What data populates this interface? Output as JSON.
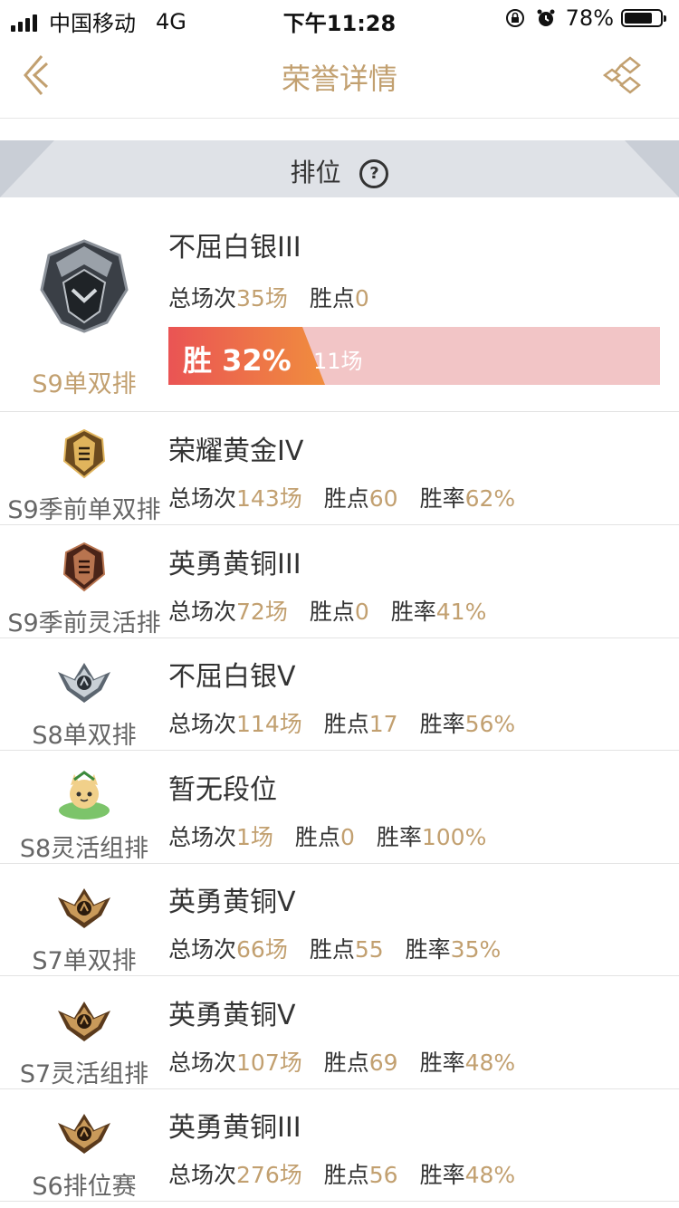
{
  "status_bar": {
    "carrier": "中国移动",
    "network": "4G",
    "time": "下午11:28",
    "battery": "78%",
    "battery_level": 0.78
  },
  "nav": {
    "title": "荣誉详情"
  },
  "section": {
    "label": "排位",
    "help": "?"
  },
  "current": {
    "queue": "S9单双排",
    "tier": "不屈白银III",
    "games_label": "总场次",
    "games": "35场",
    "points_label": "胜点",
    "points": "0",
    "win_label": "胜 32%",
    "win_games": "11场",
    "win_fraction": 0.32
  },
  "history": [
    {
      "queue": "S9季前单双排",
      "tier": "荣耀黄金IV",
      "games": "143场",
      "points": "60",
      "rate": "62%",
      "badge": "gold"
    },
    {
      "queue": "S9季前灵活排",
      "tier": "英勇黄铜III",
      "games": "72场",
      "points": "0",
      "rate": "41%",
      "badge": "bronze-dark"
    },
    {
      "queue": "S8单双排",
      "tier": "不屈白银V",
      "games": "114场",
      "points": "17",
      "rate": "56%",
      "badge": "silver"
    },
    {
      "queue": "S8灵活组排",
      "tier": "暂无段位",
      "games": "1场",
      "points": "0",
      "rate": "100%",
      "badge": "cat"
    },
    {
      "queue": "S7单双排",
      "tier": "英勇黄铜V",
      "games": "66场",
      "points": "55",
      "rate": "35%",
      "badge": "bronze"
    },
    {
      "queue": "S7灵活组排",
      "tier": "英勇黄铜V",
      "games": "107场",
      "points": "69",
      "rate": "48%",
      "badge": "bronze"
    },
    {
      "queue": "S6排位赛",
      "tier": "英勇黄铜III",
      "games": "276场",
      "points": "56",
      "rate": "48%",
      "badge": "bronze"
    }
  ],
  "labels": {
    "games": "总场次",
    "points": "胜点",
    "rate": "胜率"
  },
  "colors": {
    "accent": "#c2a070",
    "win_start": "#ea5454",
    "win_end": "#f08d3e",
    "win_bg": "#f2c5c6"
  }
}
